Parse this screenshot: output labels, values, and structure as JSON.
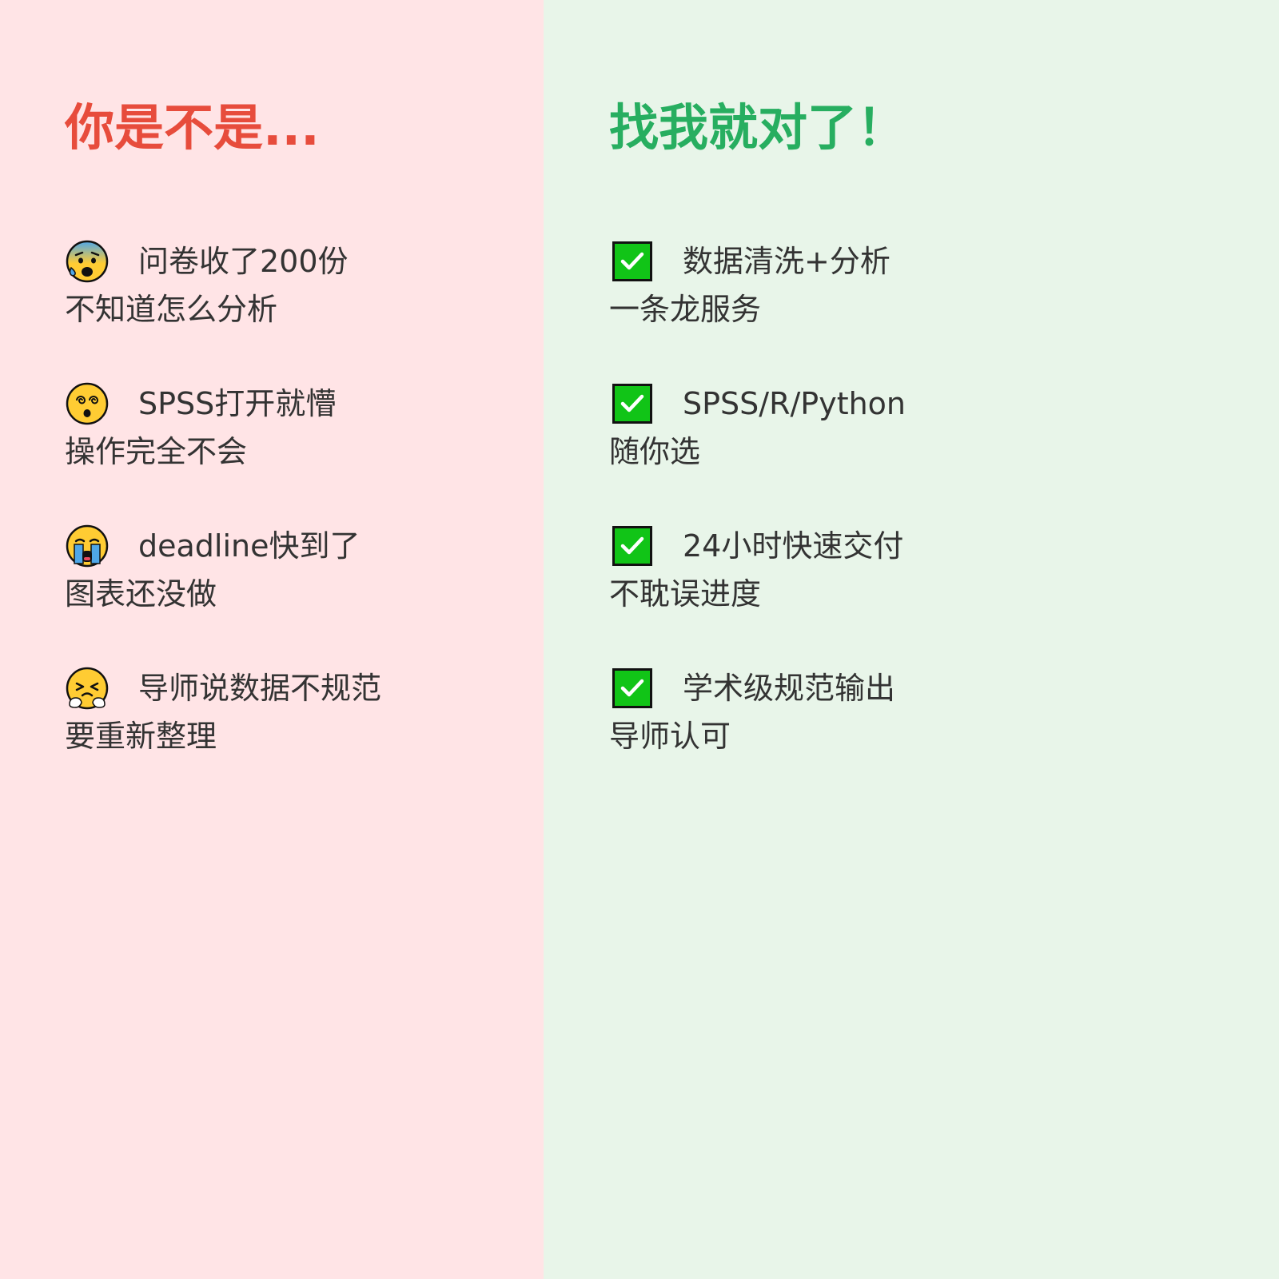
{
  "colors": {
    "left_bg": "#ffe4e6",
    "right_bg": "#e8f5e9",
    "left_heading": "#e74c3c",
    "right_heading": "#27ae60",
    "body_text": "#333333",
    "check_fill": "#11c417"
  },
  "left": {
    "heading": "你是不是...",
    "items": [
      {
        "icon": "anxious-sweat-face-icon",
        "line1": "问卷收了200份",
        "line2": "不知道怎么分析"
      },
      {
        "icon": "dizzy-face-icon",
        "line1": "SPSS打开就懵",
        "line2": "操作完全不会"
      },
      {
        "icon": "loudly-crying-face-icon",
        "line1": "deadline快到了",
        "line2": "图表还没做"
      },
      {
        "icon": "steam-from-nose-face-icon",
        "line1": "导师说数据不规范",
        "line2": "要重新整理"
      }
    ]
  },
  "right": {
    "heading": "找我就对了！",
    "items": [
      {
        "icon": "check-mark-button-icon",
        "line1": "数据清洗+分析",
        "line2": "一条龙服务"
      },
      {
        "icon": "check-mark-button-icon",
        "line1": "SPSS/R/Python",
        "line2": "随你选"
      },
      {
        "icon": "check-mark-button-icon",
        "line1": "24小时快速交付",
        "line2": "不耽误进度"
      },
      {
        "icon": "check-mark-button-icon",
        "line1": "学术级规范输出",
        "line2": "导师认可"
      }
    ]
  }
}
